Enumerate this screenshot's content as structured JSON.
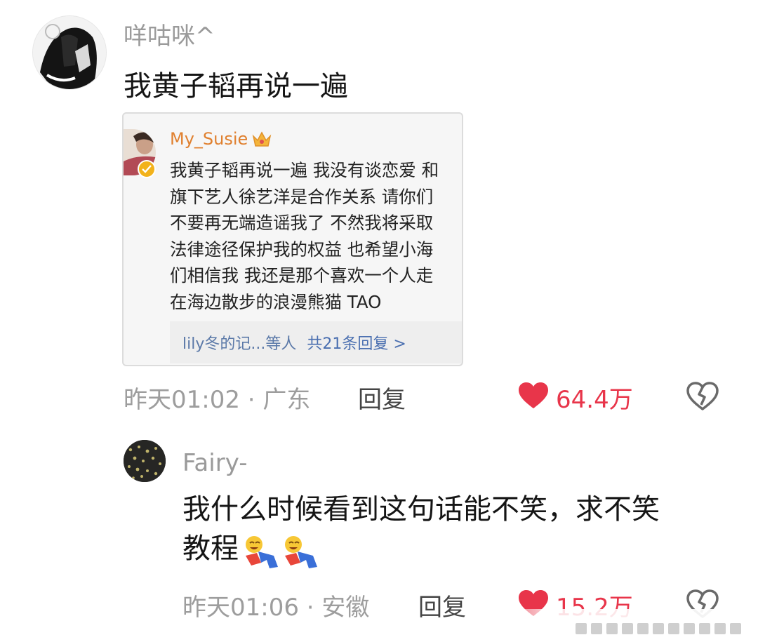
{
  "comments": [
    {
      "username": "咩咕咪^",
      "text": "我黄子韬再说一遍",
      "quote": {
        "author": "My_Susie",
        "body": "我黄子韬再说一遍 我没有谈恋爱 和\n旗下艺人徐艺洋是合作关系 请你们\n不要再无端造谣我了 不然我将采取\n法律途径保护我的权益 也希望小海\n们相信我 我还是那个喜欢一个人走\n在海边散步的浪漫熊猫 TAO",
        "reply_users": "lily冬的记...等人",
        "reply_link": "共21条回复 >"
      },
      "meta": "昨天01:02 · 广东",
      "reply_label": "回复",
      "likes": "64.4万"
    },
    {
      "username": "Fairy-",
      "text": "我什么时候看到这句话能不笑，求不笑\n教程",
      "meta": "昨天01:06 · 安徽",
      "reply_label": "回复",
      "likes": "15.2万"
    }
  ],
  "colors": {
    "like": "#e8354a",
    "muted": "#9d9d9d",
    "quote_name": "#e0802f",
    "link": "#4a6fb0"
  },
  "icons": [
    "heart-filled-icon",
    "broken-heart-icon",
    "crown-icon",
    "verified-icon",
    "emoji-icon"
  ]
}
